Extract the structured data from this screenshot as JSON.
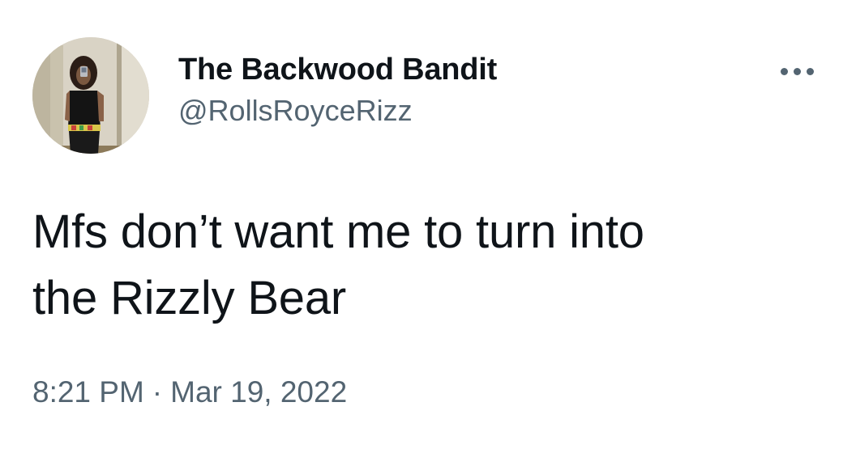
{
  "author": {
    "display_name": "The Backwood Bandit",
    "handle": "@RollsRoyceRizz"
  },
  "tweet": {
    "text_lines": [
      "Mfs don’t want me to turn into",
      "the Rizzly Bear"
    ]
  },
  "meta": {
    "time": "8:21 PM",
    "separator": "·",
    "date": "Mar 19, 2022"
  },
  "icons": {
    "more": "more-horizontal-icon"
  },
  "colors": {
    "text_primary": "#0f1419",
    "text_secondary": "#536471",
    "background": "#ffffff"
  }
}
